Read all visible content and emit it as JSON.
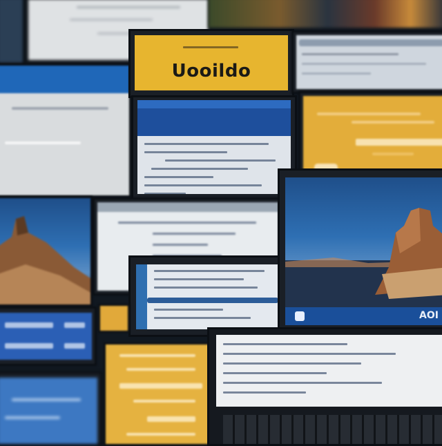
{
  "scene": {
    "background": "#111820",
    "accent_yellow": "#e7b52f",
    "accent_blue": "#1e4f9c"
  },
  "banner": {
    "logo_label": "Uooildo"
  },
  "laptop_screen": {
    "taskbar_label": "AOI"
  }
}
